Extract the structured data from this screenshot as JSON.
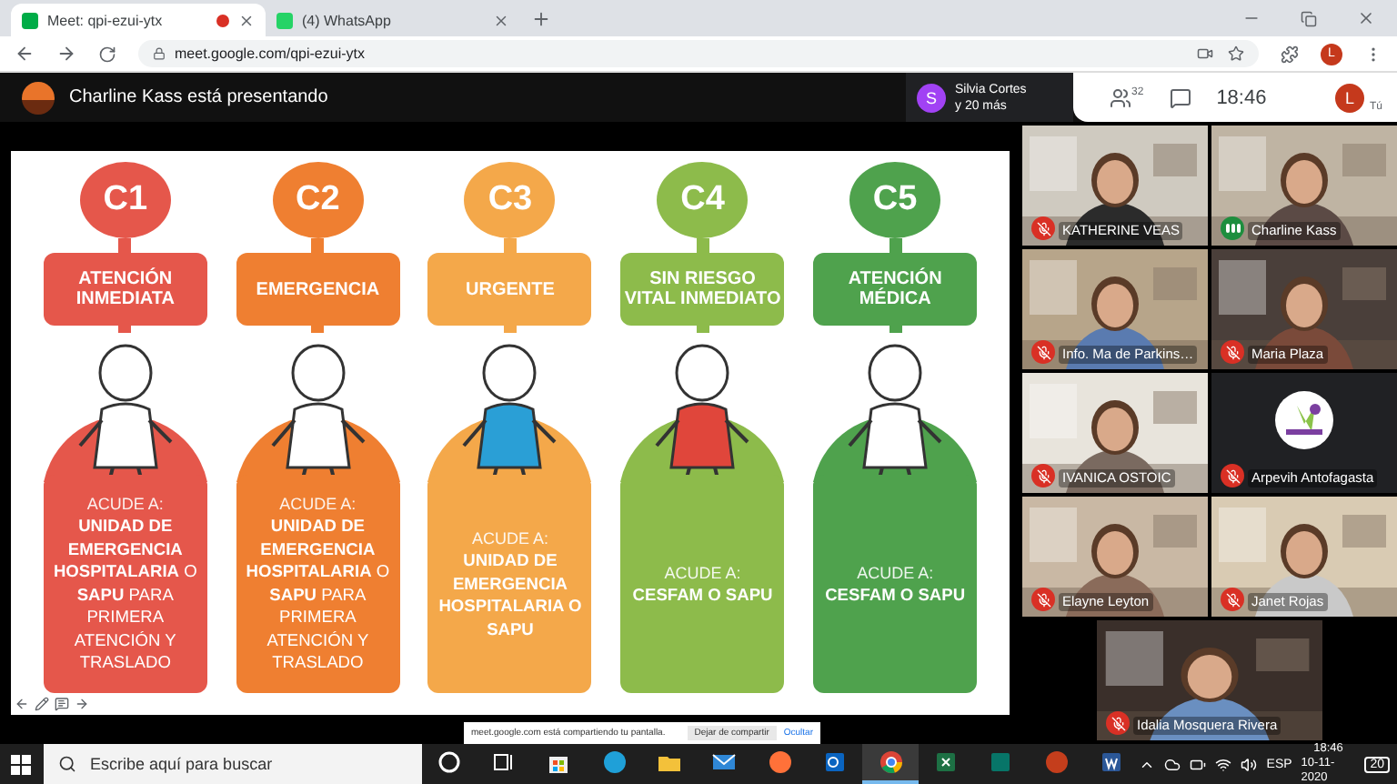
{
  "browser": {
    "tabs": [
      {
        "title": "Meet: qpi-ezui-ytx",
        "selected": true,
        "recording": true
      },
      {
        "title": "(4) WhatsApp",
        "selected": false,
        "recording": false
      }
    ],
    "address": "meet.google.com/qpi-ezui-ytx",
    "profile": "L"
  },
  "meeting": {
    "presenter_banner": "Charline Kass está presentando",
    "featured": {
      "initial": "S",
      "name": "Silvia Cortes",
      "others": "y 20 más"
    },
    "people_count": "32",
    "time": "18:46",
    "self": {
      "initial": "L",
      "label": "Tú"
    }
  },
  "slide": {
    "columns": [
      {
        "code": "C1",
        "title": "ATENCIÓN INMEDIATA",
        "color": "#e5574b",
        "lead": "ACUDE A:",
        "body": "**UNIDAD DE EMERGENCIA HOSPITALARIA** O **SAPU** PARA PRIMERA ATENCIÓN Y TRASLADO",
        "body_bold": false
      },
      {
        "code": "C2",
        "title": "EMERGENCIA",
        "color": "#ef7f31",
        "lead": "ACUDE A:",
        "body": "**UNIDAD DE EMERGENCIA HOSPITALARIA** O **SAPU** PARA PRIMERA ATENCIÓN Y TRASLADO",
        "body_bold": false
      },
      {
        "code": "C3",
        "title": "URGENTE",
        "color": "#f4a84a",
        "lead": "ACUDE A:",
        "body": "UNIDAD DE EMERGENCIA HOSPITALARIA O SAPU",
        "body_bold": true
      },
      {
        "code": "C4",
        "title": "SIN RIESGO VITAL INMEDIATO",
        "color": "#8dbb4b",
        "lead": "ACUDE A:",
        "body": "CESFAM O SAPU",
        "body_bold": true
      },
      {
        "code": "C5",
        "title": "ATENCIÓN MÉDICA",
        "color": "#4fa24d",
        "lead": "ACUDE A:",
        "body": "CESFAM O SAPU",
        "body_bold": true
      }
    ]
  },
  "participants": [
    {
      "name": "KATHERINE VEAS",
      "muted": true,
      "kind": "video"
    },
    {
      "name": "Charline Kass",
      "muted": false,
      "kind": "video"
    },
    {
      "name": "Info. Ma de Parkins…",
      "muted": true,
      "kind": "video"
    },
    {
      "name": "Maria Plaza",
      "muted": true,
      "kind": "video"
    },
    {
      "name": "IVANICA OSTOIC",
      "muted": true,
      "kind": "video"
    },
    {
      "name": "Arpevih Antofagasta",
      "muted": true,
      "kind": "logo"
    },
    {
      "name": "Elayne Leyton",
      "muted": true,
      "kind": "video"
    },
    {
      "name": "Janet Rojas",
      "muted": true,
      "kind": "video"
    },
    {
      "name": "Idalia Mosquera Rivera",
      "muted": true,
      "kind": "video"
    }
  ],
  "share_notice": {
    "message": "meet.google.com está compartiendo tu pantalla.",
    "stop": "Dejar de compartir",
    "hide": "Ocultar"
  },
  "taskbar": {
    "search_placeholder": "Escribe aquí para buscar",
    "apps": [
      {
        "kind": "cortana",
        "selected": false
      },
      {
        "kind": "taskview",
        "selected": false
      },
      {
        "kind": "store",
        "selected": false
      },
      {
        "kind": "edge",
        "selected": false
      },
      {
        "kind": "explorer",
        "selected": false
      },
      {
        "kind": "mail",
        "selected": false
      },
      {
        "kind": "firefox",
        "selected": false
      },
      {
        "kind": "outlook",
        "selected": false
      },
      {
        "kind": "chrome",
        "selected": true
      },
      {
        "kind": "excel",
        "selected": false
      },
      {
        "kind": "publisher",
        "selected": false
      },
      {
        "kind": "powerpoint",
        "selected": false
      },
      {
        "kind": "word",
        "selected": false
      }
    ],
    "language": "ESP",
    "time": "18:46",
    "date": "10-11-2020",
    "notifications": "20"
  }
}
